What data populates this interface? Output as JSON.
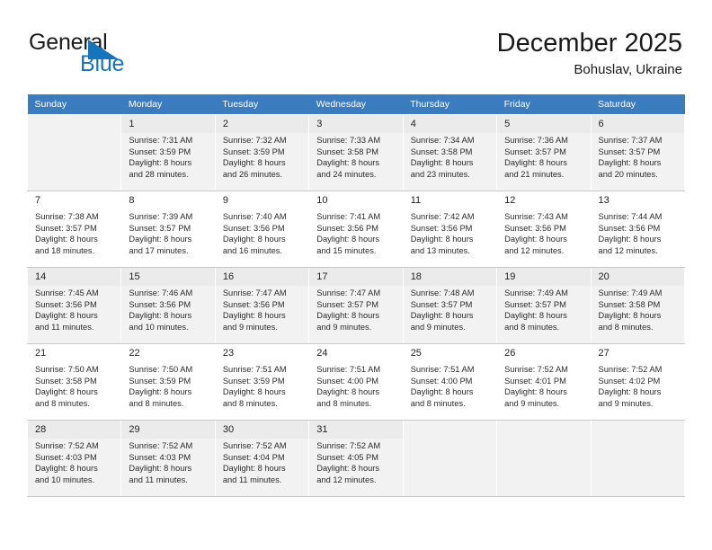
{
  "brand": {
    "name_part1": "General",
    "name_part2": "Blue",
    "triangle_color": "#1574bb",
    "icon": "triangle-logo-icon"
  },
  "header": {
    "month_title": "December 2025",
    "location": "Bohuslav, Ukraine"
  },
  "theme": {
    "header_row_bg": "#3a7cbe",
    "header_row_text": "#ffffff",
    "shaded_row_bg": "#f2f2f2",
    "daynum_bg": "#ebebeb",
    "grid_line": "#c8c8c8"
  },
  "weekday_headers": [
    "Sunday",
    "Monday",
    "Tuesday",
    "Wednesday",
    "Thursday",
    "Friday",
    "Saturday"
  ],
  "weeks": [
    {
      "shaded": true,
      "days": [
        {
          "day": "",
          "sunrise": "",
          "sunset": "",
          "daylight1": "",
          "daylight2": "",
          "empty": true
        },
        {
          "day": "1",
          "sunrise": "Sunrise: 7:31 AM",
          "sunset": "Sunset: 3:59 PM",
          "daylight1": "Daylight: 8 hours",
          "daylight2": "and 28 minutes.",
          "empty": false
        },
        {
          "day": "2",
          "sunrise": "Sunrise: 7:32 AM",
          "sunset": "Sunset: 3:59 PM",
          "daylight1": "Daylight: 8 hours",
          "daylight2": "and 26 minutes.",
          "empty": false
        },
        {
          "day": "3",
          "sunrise": "Sunrise: 7:33 AM",
          "sunset": "Sunset: 3:58 PM",
          "daylight1": "Daylight: 8 hours",
          "daylight2": "and 24 minutes.",
          "empty": false
        },
        {
          "day": "4",
          "sunrise": "Sunrise: 7:34 AM",
          "sunset": "Sunset: 3:58 PM",
          "daylight1": "Daylight: 8 hours",
          "daylight2": "and 23 minutes.",
          "empty": false
        },
        {
          "day": "5",
          "sunrise": "Sunrise: 7:36 AM",
          "sunset": "Sunset: 3:57 PM",
          "daylight1": "Daylight: 8 hours",
          "daylight2": "and 21 minutes.",
          "empty": false
        },
        {
          "day": "6",
          "sunrise": "Sunrise: 7:37 AM",
          "sunset": "Sunset: 3:57 PM",
          "daylight1": "Daylight: 8 hours",
          "daylight2": "and 20 minutes.",
          "empty": false
        }
      ]
    },
    {
      "shaded": false,
      "days": [
        {
          "day": "7",
          "sunrise": "Sunrise: 7:38 AM",
          "sunset": "Sunset: 3:57 PM",
          "daylight1": "Daylight: 8 hours",
          "daylight2": "and 18 minutes.",
          "empty": false
        },
        {
          "day": "8",
          "sunrise": "Sunrise: 7:39 AM",
          "sunset": "Sunset: 3:57 PM",
          "daylight1": "Daylight: 8 hours",
          "daylight2": "and 17 minutes.",
          "empty": false
        },
        {
          "day": "9",
          "sunrise": "Sunrise: 7:40 AM",
          "sunset": "Sunset: 3:56 PM",
          "daylight1": "Daylight: 8 hours",
          "daylight2": "and 16 minutes.",
          "empty": false
        },
        {
          "day": "10",
          "sunrise": "Sunrise: 7:41 AM",
          "sunset": "Sunset: 3:56 PM",
          "daylight1": "Daylight: 8 hours",
          "daylight2": "and 15 minutes.",
          "empty": false
        },
        {
          "day": "11",
          "sunrise": "Sunrise: 7:42 AM",
          "sunset": "Sunset: 3:56 PM",
          "daylight1": "Daylight: 8 hours",
          "daylight2": "and 13 minutes.",
          "empty": false
        },
        {
          "day": "12",
          "sunrise": "Sunrise: 7:43 AM",
          "sunset": "Sunset: 3:56 PM",
          "daylight1": "Daylight: 8 hours",
          "daylight2": "and 12 minutes.",
          "empty": false
        },
        {
          "day": "13",
          "sunrise": "Sunrise: 7:44 AM",
          "sunset": "Sunset: 3:56 PM",
          "daylight1": "Daylight: 8 hours",
          "daylight2": "and 12 minutes.",
          "empty": false
        }
      ]
    },
    {
      "shaded": true,
      "days": [
        {
          "day": "14",
          "sunrise": "Sunrise: 7:45 AM",
          "sunset": "Sunset: 3:56 PM",
          "daylight1": "Daylight: 8 hours",
          "daylight2": "and 11 minutes.",
          "empty": false
        },
        {
          "day": "15",
          "sunrise": "Sunrise: 7:46 AM",
          "sunset": "Sunset: 3:56 PM",
          "daylight1": "Daylight: 8 hours",
          "daylight2": "and 10 minutes.",
          "empty": false
        },
        {
          "day": "16",
          "sunrise": "Sunrise: 7:47 AM",
          "sunset": "Sunset: 3:56 PM",
          "daylight1": "Daylight: 8 hours",
          "daylight2": "and 9 minutes.",
          "empty": false
        },
        {
          "day": "17",
          "sunrise": "Sunrise: 7:47 AM",
          "sunset": "Sunset: 3:57 PM",
          "daylight1": "Daylight: 8 hours",
          "daylight2": "and 9 minutes.",
          "empty": false
        },
        {
          "day": "18",
          "sunrise": "Sunrise: 7:48 AM",
          "sunset": "Sunset: 3:57 PM",
          "daylight1": "Daylight: 8 hours",
          "daylight2": "and 9 minutes.",
          "empty": false
        },
        {
          "day": "19",
          "sunrise": "Sunrise: 7:49 AM",
          "sunset": "Sunset: 3:57 PM",
          "daylight1": "Daylight: 8 hours",
          "daylight2": "and 8 minutes.",
          "empty": false
        },
        {
          "day": "20",
          "sunrise": "Sunrise: 7:49 AM",
          "sunset": "Sunset: 3:58 PM",
          "daylight1": "Daylight: 8 hours",
          "daylight2": "and 8 minutes.",
          "empty": false
        }
      ]
    },
    {
      "shaded": false,
      "days": [
        {
          "day": "21",
          "sunrise": "Sunrise: 7:50 AM",
          "sunset": "Sunset: 3:58 PM",
          "daylight1": "Daylight: 8 hours",
          "daylight2": "and 8 minutes.",
          "empty": false
        },
        {
          "day": "22",
          "sunrise": "Sunrise: 7:50 AM",
          "sunset": "Sunset: 3:59 PM",
          "daylight1": "Daylight: 8 hours",
          "daylight2": "and 8 minutes.",
          "empty": false
        },
        {
          "day": "23",
          "sunrise": "Sunrise: 7:51 AM",
          "sunset": "Sunset: 3:59 PM",
          "daylight1": "Daylight: 8 hours",
          "daylight2": "and 8 minutes.",
          "empty": false
        },
        {
          "day": "24",
          "sunrise": "Sunrise: 7:51 AM",
          "sunset": "Sunset: 4:00 PM",
          "daylight1": "Daylight: 8 hours",
          "daylight2": "and 8 minutes.",
          "empty": false
        },
        {
          "day": "25",
          "sunrise": "Sunrise: 7:51 AM",
          "sunset": "Sunset: 4:00 PM",
          "daylight1": "Daylight: 8 hours",
          "daylight2": "and 8 minutes.",
          "empty": false
        },
        {
          "day": "26",
          "sunrise": "Sunrise: 7:52 AM",
          "sunset": "Sunset: 4:01 PM",
          "daylight1": "Daylight: 8 hours",
          "daylight2": "and 9 minutes.",
          "empty": false
        },
        {
          "day": "27",
          "sunrise": "Sunrise: 7:52 AM",
          "sunset": "Sunset: 4:02 PM",
          "daylight1": "Daylight: 8 hours",
          "daylight2": "and 9 minutes.",
          "empty": false
        }
      ]
    },
    {
      "shaded": true,
      "days": [
        {
          "day": "28",
          "sunrise": "Sunrise: 7:52 AM",
          "sunset": "Sunset: 4:03 PM",
          "daylight1": "Daylight: 8 hours",
          "daylight2": "and 10 minutes.",
          "empty": false
        },
        {
          "day": "29",
          "sunrise": "Sunrise: 7:52 AM",
          "sunset": "Sunset: 4:03 PM",
          "daylight1": "Daylight: 8 hours",
          "daylight2": "and 11 minutes.",
          "empty": false
        },
        {
          "day": "30",
          "sunrise": "Sunrise: 7:52 AM",
          "sunset": "Sunset: 4:04 PM",
          "daylight1": "Daylight: 8 hours",
          "daylight2": "and 11 minutes.",
          "empty": false
        },
        {
          "day": "31",
          "sunrise": "Sunrise: 7:52 AM",
          "sunset": "Sunset: 4:05 PM",
          "daylight1": "Daylight: 8 hours",
          "daylight2": "and 12 minutes.",
          "empty": false
        },
        {
          "day": "",
          "sunrise": "",
          "sunset": "",
          "daylight1": "",
          "daylight2": "",
          "empty": true
        },
        {
          "day": "",
          "sunrise": "",
          "sunset": "",
          "daylight1": "",
          "daylight2": "",
          "empty": true
        },
        {
          "day": "",
          "sunrise": "",
          "sunset": "",
          "daylight1": "",
          "daylight2": "",
          "empty": true
        }
      ]
    }
  ]
}
